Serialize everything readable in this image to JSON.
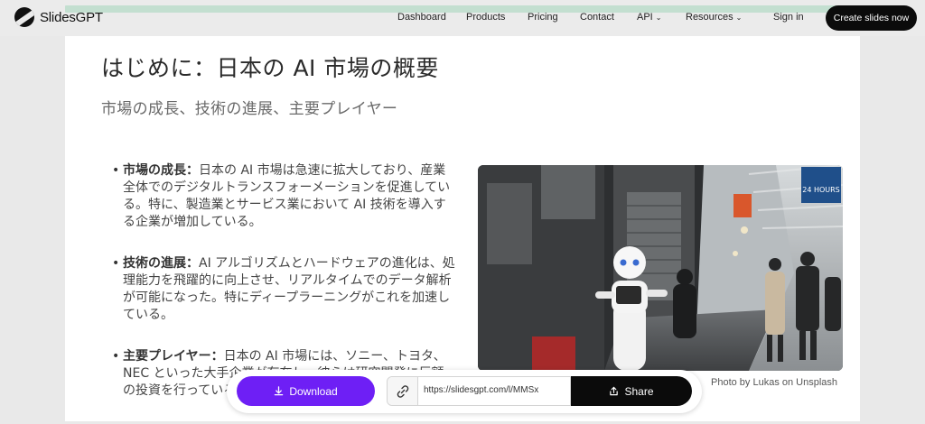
{
  "nav": {
    "logo_text": "SlidesGPT",
    "links": [
      "Dashboard",
      "Products",
      "Pricing",
      "Contact",
      "API",
      "Resources",
      "Sign in"
    ],
    "cta_label": "Create slides now",
    "progress": 1.0
  },
  "slide": {
    "title": "はじめに：日本の AI 市場の概要",
    "subtitle": "市場の成長、技術の進展、主要プレイヤー",
    "bullets": [
      {
        "heading": "市場の成長：",
        "text": "日本の AI 市場は急速に拡大しており、産業全体でのデジタルトランスフォーメーションを促進している。特に、製造業とサービス業において AI 技術を導入する企業が増加している。"
      },
      {
        "heading": "技術の進展：",
        "text": "AI アルゴリズムとハードウェアの進化は、処理能力を飛躍的に向上させ、リアルタイムでのデータ解析が可能になった。特にディープラーニングがこれを加速している。"
      },
      {
        "heading": "主要プレイヤー：",
        "text": "日本の AI 市場には、ソニー、トヨタ、NEC といった大手企業が存在し、彼らは研究開発に巨額の投資を行っている。"
      }
    ],
    "photo_sign_text": "24 HOURS",
    "photo_caption": "Photo by Lukas on Unsplash"
  },
  "share": {
    "download_label": "Download",
    "link_url": "https://slidesgpt.com/l/MMSx",
    "share_label": "Share"
  },
  "colors": {
    "download": "#6e1ff5",
    "dark": "#0b0b0b",
    "progress": "#c3dfd0"
  }
}
